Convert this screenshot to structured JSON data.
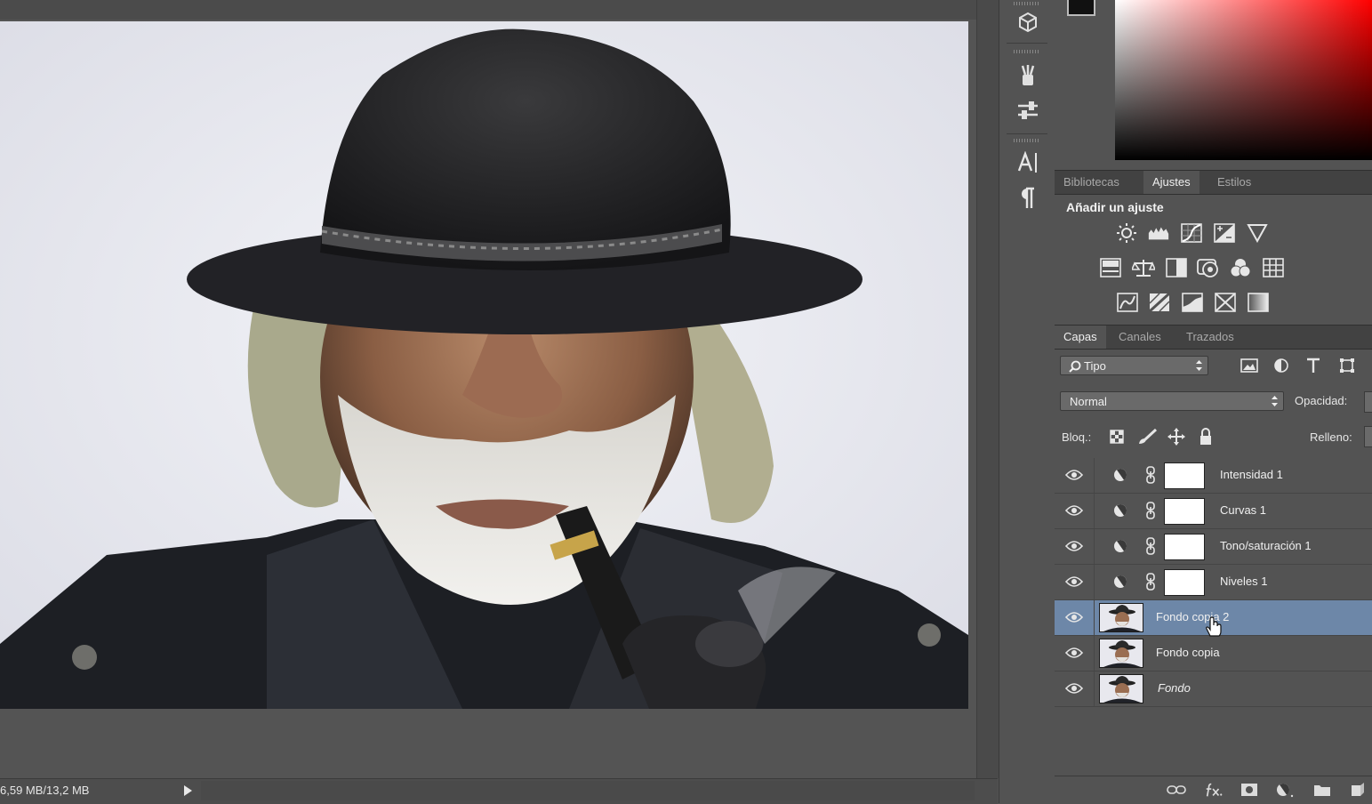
{
  "status": {
    "doc_size": "6,59 MB/13,2 MB"
  },
  "panels": {
    "top_tabs": [
      "Bibliotecas",
      "Ajustes",
      "Estilos"
    ],
    "top_active": "Ajustes",
    "adjustments": {
      "title": "Añadir un ajuste",
      "icons": [
        [
          "brightness-icon",
          "levels-icon",
          "curves-icon",
          "exposure-icon",
          "vibrance-icon"
        ],
        [
          "hue-saturation-icon",
          "color-balance-icon",
          "black-white-icon",
          "photo-filter-icon",
          "channel-mixer-icon",
          "color-lookup-icon"
        ],
        [
          "invert-icon",
          "posterize-icon",
          "threshold-icon",
          "selective-color-icon",
          "gradient-map-icon"
        ]
      ]
    },
    "layer_tabs": [
      "Capas",
      "Canales",
      "Trazados"
    ],
    "layer_active": "Capas",
    "filter_select": "Tipo",
    "blend_mode": "Normal",
    "opacity_label": "Opacidad:",
    "lock_label": "Bloq.:",
    "fill_label": "Relleno:",
    "layers": [
      {
        "name": "Intensidad 1",
        "type": "adjustment",
        "visible": true,
        "selected": false
      },
      {
        "name": "Curvas 1",
        "type": "adjustment",
        "visible": true,
        "selected": false
      },
      {
        "name": "Tono/saturación 1",
        "type": "adjustment",
        "visible": true,
        "selected": false
      },
      {
        "name": "Niveles 1",
        "type": "adjustment",
        "visible": true,
        "selected": false
      },
      {
        "name": "Fondo copia 2",
        "type": "pixel",
        "visible": true,
        "selected": true
      },
      {
        "name": "Fondo copia",
        "type": "pixel",
        "visible": true,
        "selected": false
      },
      {
        "name": "Fondo",
        "type": "background",
        "visible": true,
        "selected": false,
        "italic": true
      }
    ],
    "footer_icons": [
      "link-layers-icon",
      "fx-icon",
      "add-mask-icon",
      "new-adjustment-icon",
      "new-group-icon",
      "new-layer-icon"
    ]
  },
  "dock": {
    "icons": [
      "3d-icon",
      "brush-presets-icon",
      "adjust-sliders-icon",
      "character-icon",
      "paragraph-icon"
    ]
  },
  "colors": {
    "selected_layer": "#6d87a8",
    "panel_bg": "#535353",
    "tab_bg": "#424242"
  }
}
